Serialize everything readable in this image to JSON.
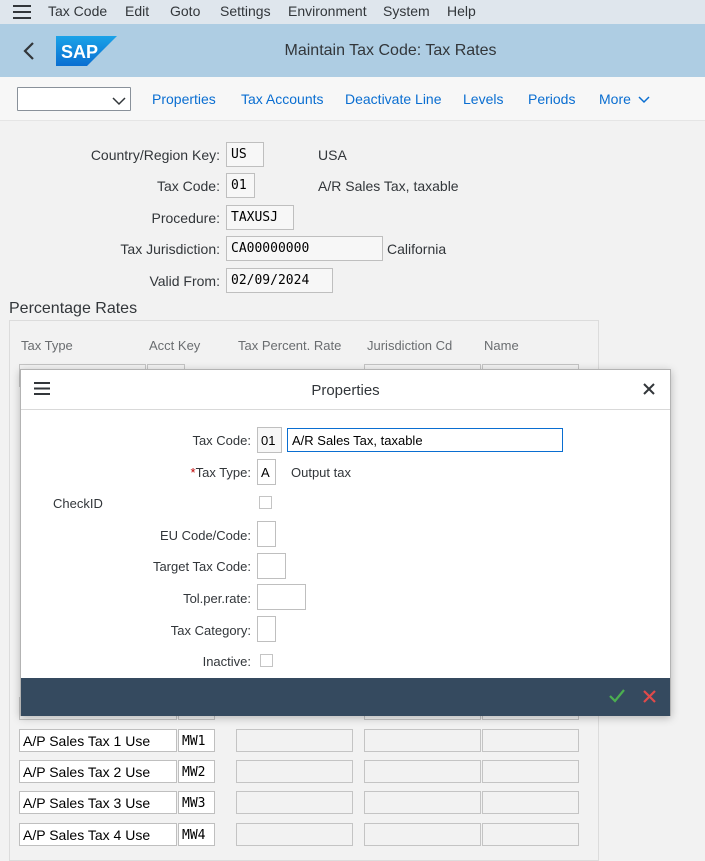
{
  "menubar": {
    "items": [
      {
        "label": "Tax Code"
      },
      {
        "label": "Edit"
      },
      {
        "label": "Goto"
      },
      {
        "label": "Settings"
      },
      {
        "label": "Environment"
      },
      {
        "label": "System"
      },
      {
        "label": "Help"
      }
    ]
  },
  "titlebar": {
    "logo": "SAP",
    "title": "Maintain Tax Code: Tax Rates"
  },
  "toolbar": {
    "select_value": "",
    "buttons": [
      {
        "label": "Properties"
      },
      {
        "label": "Tax Accounts"
      },
      {
        "label": "Deactivate Line"
      },
      {
        "label": "Levels"
      },
      {
        "label": "Periods"
      },
      {
        "label": "More"
      }
    ]
  },
  "header": {
    "country": {
      "label": "Country/Region Key:",
      "value": "US",
      "text": "USA"
    },
    "tax_code": {
      "label": "Tax Code:",
      "value": "01",
      "text": "A/R Sales Tax, taxable"
    },
    "procedure": {
      "label": "Procedure:",
      "value": "TAXUSJ"
    },
    "jurisdiction": {
      "label": "Tax Jurisdiction:",
      "value": "CA00000000",
      "text": "California"
    },
    "valid_from": {
      "label": "Valid From:",
      "value": "02/09/2024"
    }
  },
  "rates": {
    "title": "Percentage Rates",
    "columns": [
      "Tax Type",
      "Acct Key",
      "Tax Percent. Rate",
      "Jurisdiction Cd",
      "Name"
    ],
    "rows": [
      {
        "tax_type": "A/P Sales Tax 1 Use",
        "acct_key": "MW1",
        "rate": "",
        "jurisdiction": "",
        "name": ""
      },
      {
        "tax_type": "A/P Sales Tax 2 Use",
        "acct_key": "MW2",
        "rate": "",
        "jurisdiction": "",
        "name": ""
      },
      {
        "tax_type": "A/P Sales Tax 3 Use",
        "acct_key": "MW3",
        "rate": "",
        "jurisdiction": "",
        "name": ""
      },
      {
        "tax_type": "A/P Sales Tax 4 Use",
        "acct_key": "MW4",
        "rate": "",
        "jurisdiction": "",
        "name": ""
      }
    ]
  },
  "dialog": {
    "title": "Properties",
    "tax_code": {
      "label": "Tax Code:",
      "value": "01",
      "description": "A/R Sales Tax, taxable"
    },
    "tax_type": {
      "required_mark": "*",
      "label": "Tax Type:",
      "value": "A",
      "text": "Output tax"
    },
    "check_id": {
      "label": "CheckID",
      "checked": false
    },
    "eu_code": {
      "label": "EU Code/Code:",
      "value": ""
    },
    "target_tax_code": {
      "label": "Target Tax Code:",
      "value": ""
    },
    "tol_per_rate": {
      "label": "Tol.per.rate:",
      "value": ""
    },
    "tax_category": {
      "label": "Tax Category:",
      "value": ""
    },
    "inactive": {
      "label": "Inactive:",
      "checked": false
    }
  },
  "colors": {
    "menubar_bg": "#dfe6ed",
    "titlebar_bg": "#aecde3",
    "link_blue": "#0a6ed1",
    "footer_bg": "#354a5f",
    "ok_green": "#2b7d2b",
    "cancel_red": "#bb0000"
  },
  "icons": {
    "menu": "hamburger-icon",
    "back": "back-arrow-icon",
    "chevron": "chevron-down-icon",
    "close": "close-icon",
    "ok": "check-icon",
    "cancel": "cancel-icon"
  }
}
